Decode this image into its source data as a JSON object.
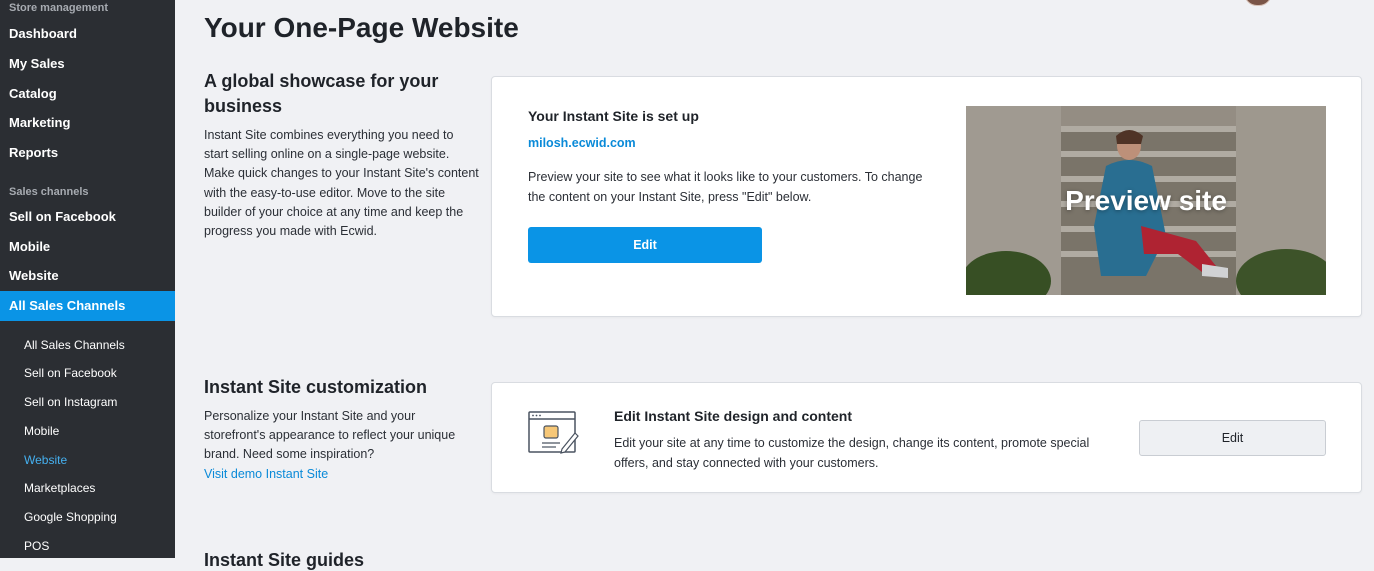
{
  "sidebar": {
    "store_section": "Store management",
    "store_items": [
      "Dashboard",
      "My Sales",
      "Catalog",
      "Marketing",
      "Reports"
    ],
    "channels_section": "Sales channels",
    "channel_items": [
      "Sell on Facebook",
      "Mobile",
      "Website",
      "All Sales Channels"
    ],
    "active_item": "All Sales Channels",
    "sub_items": [
      "All Sales Channels",
      "Sell on Facebook",
      "Sell on Instagram",
      "Mobile",
      "Website",
      "Marketplaces",
      "Google Shopping",
      "POS"
    ],
    "active_sub_item": "Website",
    "accent_color": "#0a94e6"
  },
  "page": {
    "title": "Your One-Page Website"
  },
  "showcase": {
    "heading": "A global showcase for your business",
    "body": "Instant Site combines everything you need to start selling online on a single-page website. Make quick changes to your Instant Site's content with the easy-to-use editor. Move to the site builder of your choice at any time and keep the progress you made with Ecwid."
  },
  "instant_site_card": {
    "title": "Your Instant Site is set up",
    "url": "milosh.ecwid.com",
    "description": "Preview your site to see what it looks like to your customers. To change the content on your Instant Site, press \"Edit\" below.",
    "edit_label": "Edit",
    "preview_label": "Preview site"
  },
  "customization": {
    "heading": "Instant Site customization",
    "body": "Personalize your Instant Site and your storefront's appearance to reflect your unique brand. Need some inspiration?",
    "link": "Visit demo Instant Site"
  },
  "design_card": {
    "icon": "design-editor-icon",
    "title": "Edit Instant Site design and content",
    "description": "Edit your site at any time to customize the design, change its content, promote special offers, and stay connected with your customers.",
    "edit_label": "Edit"
  },
  "next_section_heading": "Instant Site guides"
}
